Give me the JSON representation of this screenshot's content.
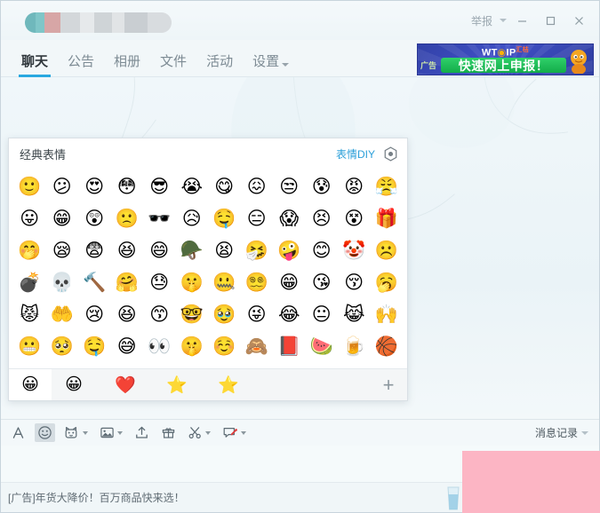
{
  "window": {
    "title_redacted": true,
    "report_label": "举报",
    "minimize_label": "最小化",
    "maximize_label": "最大化",
    "close_label": "关闭"
  },
  "nav": {
    "tabs": [
      {
        "label": "聊天",
        "active": true,
        "has_caret": false
      },
      {
        "label": "公告",
        "active": false,
        "has_caret": false
      },
      {
        "label": "相册",
        "active": false,
        "has_caret": false
      },
      {
        "label": "文件",
        "active": false,
        "has_caret": false
      },
      {
        "label": "活动",
        "active": false,
        "has_caret": false
      },
      {
        "label": "设置",
        "active": false,
        "has_caret": true
      }
    ]
  },
  "top_ad": {
    "tag": "广告",
    "logo_main": "WT",
    "logo_dot": "◉",
    "logo_rest": "IP",
    "logo_sub": "汇桔",
    "headline": "快速网上申报！"
  },
  "emoji_panel": {
    "title": "经典表情",
    "diy_label": "表情DIY",
    "gear_icon": "gear-icon",
    "columns": 12,
    "rows": 6,
    "emojis": [
      "🙂",
      "😕",
      "😍",
      "😳",
      "😎",
      "😭",
      "😋",
      "😖",
      "😒",
      "😰",
      "😡",
      "😤",
      "😛",
      "😁",
      "😲",
      "🙁",
      "🕶️",
      "😥",
      "🤤",
      "😑",
      "😱",
      "😣",
      "😵",
      "🎁",
      "🤭",
      "😪",
      "😨",
      "😆",
      "😄",
      "🪖",
      "😫",
      "🤧",
      "🤪",
      "😊",
      "🤡",
      "☹️",
      "💣",
      "💀",
      "🔨",
      "🤗",
      "😓",
      "🤫",
      "🤐",
      "😵‍💫",
      "😁",
      "😘",
      "😚",
      "🥱",
      "😾",
      "🤲",
      "😢",
      "😆",
      "😙",
      "🤓",
      "🥹",
      "😜",
      "😂",
      "😐",
      "😹",
      "🙌",
      "😬",
      "🥺",
      "🤤",
      "😅",
      "👀",
      "🤫",
      "☺️",
      "🙈",
      "📕",
      "🍉",
      "🍺",
      "🏀"
    ],
    "tabs": [
      {
        "icon": "😀",
        "name": "classic-emoji-tab",
        "active": true
      },
      {
        "icon": "😀",
        "name": "emoji-tab-2",
        "active": false
      },
      {
        "icon": "❤️",
        "name": "heart-tab",
        "active": false
      },
      {
        "icon": "⭐",
        "name": "star-tab-1",
        "active": false
      },
      {
        "icon": "⭐",
        "name": "star-tab-2",
        "active": false
      }
    ],
    "add_label": "+"
  },
  "toolbar": {
    "items": [
      {
        "name": "font-button",
        "icon": "font-icon",
        "caret": false,
        "active": false
      },
      {
        "name": "emoji-button",
        "icon": "smiley-icon",
        "caret": false,
        "active": true
      },
      {
        "name": "sticker-button",
        "icon": "cat-face-icon",
        "caret": true,
        "active": false
      },
      {
        "name": "image-button",
        "icon": "image-icon",
        "caret": true,
        "active": false
      },
      {
        "name": "file-upload-button",
        "icon": "upload-icon",
        "caret": false,
        "active": false
      },
      {
        "name": "gift-button",
        "icon": "gift-icon",
        "caret": false,
        "active": false
      },
      {
        "name": "screenshot-button",
        "icon": "scissors-icon",
        "caret": true,
        "active": false
      },
      {
        "name": "shake-button",
        "icon": "screen-marker-icon",
        "caret": true,
        "active": false
      }
    ],
    "history_label": "消息记录"
  },
  "input": {
    "value": "",
    "placeholder": ""
  },
  "bottom_ad": {
    "text": "[广告]年货大降价！百万商品快来选！",
    "cup_icon": "cup-icon"
  },
  "colors": {
    "accent": "#29a8e0",
    "link": "#2b9fd9",
    "panel_bg": "#ffffff",
    "window_bg": "#f2f7f9",
    "redaction_pink": "#fcb5c4",
    "ad_green": "#13ad49",
    "ad_blue": "#3241a8"
  }
}
